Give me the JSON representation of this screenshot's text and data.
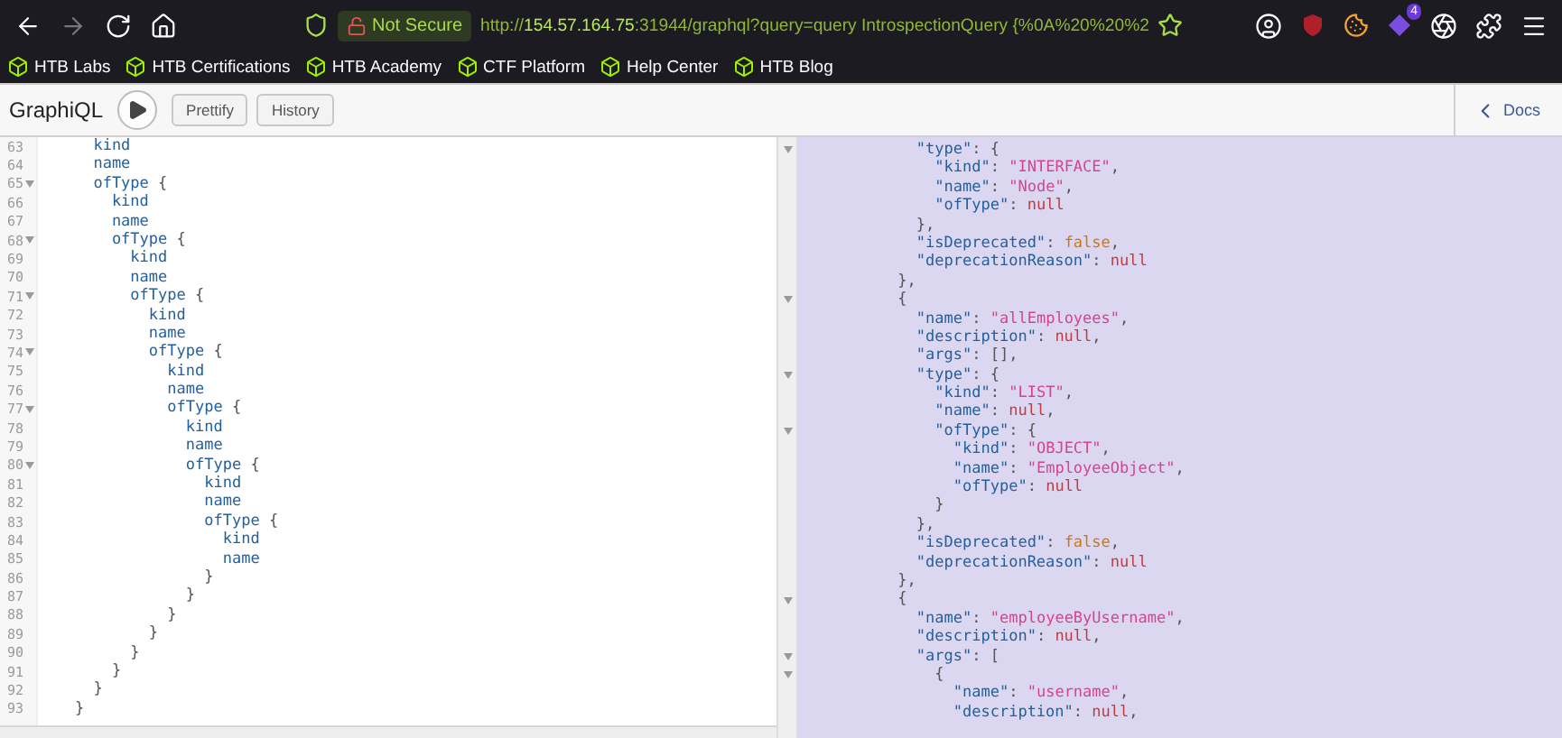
{
  "browser": {
    "security_badge": "Not Secure",
    "url": "http://**154.57.164.75**:31944/graphql?query=query IntrospectionQuery {%0A%20%20%2",
    "extension_badge": "4",
    "bookmarks": [
      "HTB Labs",
      "HTB Certifications",
      "HTB Academy",
      "CTF Platform",
      "Help Center",
      "HTB Blog"
    ]
  },
  "graphiql": {
    "title": "GraphiQL",
    "buttons": [
      "Prettify",
      "History"
    ],
    "docs_button": "Docs",
    "query_editor": {
      "lines": [
        {
          "number": "63",
          "foldable": false,
          "tokens": [
            {
              "kind": "field",
              "text": "      kind"
            }
          ]
        },
        {
          "number": "64",
          "foldable": false,
          "tokens": [
            {
              "kind": "field",
              "text": "      name"
            }
          ]
        },
        {
          "number": "65",
          "foldable": true,
          "tokens": [
            {
              "kind": "field",
              "text": "      ofType"
            },
            {
              "kind": "punct",
              "text": " {"
            }
          ]
        },
        {
          "number": "66",
          "foldable": false,
          "tokens": [
            {
              "kind": "field",
              "text": "        kind"
            }
          ]
        },
        {
          "number": "67",
          "foldable": false,
          "tokens": [
            {
              "kind": "field",
              "text": "        name"
            }
          ]
        },
        {
          "number": "68",
          "foldable": true,
          "tokens": [
            {
              "kind": "field",
              "text": "        ofType"
            },
            {
              "kind": "punct",
              "text": " {"
            }
          ]
        },
        {
          "number": "69",
          "foldable": false,
          "tokens": [
            {
              "kind": "field",
              "text": "          kind"
            }
          ]
        },
        {
          "number": "70",
          "foldable": false,
          "tokens": [
            {
              "kind": "field",
              "text": "          name"
            }
          ]
        },
        {
          "number": "71",
          "foldable": true,
          "tokens": [
            {
              "kind": "field",
              "text": "          ofType"
            },
            {
              "kind": "punct",
              "text": " {"
            }
          ]
        },
        {
          "number": "72",
          "foldable": false,
          "tokens": [
            {
              "kind": "field",
              "text": "            kind"
            }
          ]
        },
        {
          "number": "73",
          "foldable": false,
          "tokens": [
            {
              "kind": "field",
              "text": "            name"
            }
          ]
        },
        {
          "number": "74",
          "foldable": true,
          "tokens": [
            {
              "kind": "field",
              "text": "            ofType"
            },
            {
              "kind": "punct",
              "text": " {"
            }
          ]
        },
        {
          "number": "75",
          "foldable": false,
          "tokens": [
            {
              "kind": "field",
              "text": "              kind"
            }
          ]
        },
        {
          "number": "76",
          "foldable": false,
          "tokens": [
            {
              "kind": "field",
              "text": "              name"
            }
          ]
        },
        {
          "number": "77",
          "foldable": true,
          "tokens": [
            {
              "kind": "field",
              "text": "              ofType"
            },
            {
              "kind": "punct",
              "text": " {"
            }
          ]
        },
        {
          "number": "78",
          "foldable": false,
          "tokens": [
            {
              "kind": "field",
              "text": "                kind"
            }
          ]
        },
        {
          "number": "79",
          "foldable": false,
          "tokens": [
            {
              "kind": "field",
              "text": "                name"
            }
          ]
        },
        {
          "number": "80",
          "foldable": true,
          "tokens": [
            {
              "kind": "field",
              "text": "                ofType"
            },
            {
              "kind": "punct",
              "text": " {"
            }
          ]
        },
        {
          "number": "81",
          "foldable": false,
          "tokens": [
            {
              "kind": "field",
              "text": "                  kind"
            }
          ]
        },
        {
          "number": "82",
          "foldable": false,
          "tokens": [
            {
              "kind": "field",
              "text": "                  name"
            }
          ]
        },
        {
          "number": "83",
          "foldable": false,
          "tokens": [
            {
              "kind": "field",
              "text": "                  ofType"
            },
            {
              "kind": "punct",
              "text": " {"
            }
          ]
        },
        {
          "number": "84",
          "foldable": false,
          "tokens": [
            {
              "kind": "field",
              "text": "                    kind"
            }
          ]
        },
        {
          "number": "85",
          "foldable": false,
          "tokens": [
            {
              "kind": "field",
              "text": "                    name"
            }
          ]
        },
        {
          "number": "86",
          "foldable": false,
          "tokens": [
            {
              "kind": "punct",
              "text": "                  }"
            }
          ]
        },
        {
          "number": "87",
          "foldable": false,
          "tokens": [
            {
              "kind": "punct",
              "text": "                }"
            }
          ]
        },
        {
          "number": "88",
          "foldable": false,
          "tokens": [
            {
              "kind": "punct",
              "text": "              }"
            }
          ]
        },
        {
          "number": "89",
          "foldable": false,
          "tokens": [
            {
              "kind": "punct",
              "text": "            }"
            }
          ]
        },
        {
          "number": "90",
          "foldable": false,
          "tokens": [
            {
              "kind": "punct",
              "text": "          }"
            }
          ]
        },
        {
          "number": "91",
          "foldable": false,
          "tokens": [
            {
              "kind": "punct",
              "text": "        }"
            }
          ]
        },
        {
          "number": "92",
          "foldable": false,
          "tokens": [
            {
              "kind": "punct",
              "text": "      }"
            }
          ]
        },
        {
          "number": "93",
          "foldable": false,
          "tokens": [
            {
              "kind": "punct",
              "text": "    }"
            }
          ]
        }
      ]
    },
    "result_viewer": {
      "lines": [
        {
          "foldable": true,
          "tokens": [
            {
              "kind": "key",
              "text": "            \"type\""
            },
            {
              "kind": "punct",
              "text": ": {"
            }
          ]
        },
        {
          "foldable": false,
          "tokens": [
            {
              "kind": "key",
              "text": "              \"kind\""
            },
            {
              "kind": "punct",
              "text": ": "
            },
            {
              "kind": "string",
              "text": "\"INTERFACE\""
            },
            {
              "kind": "punct",
              "text": ","
            }
          ]
        },
        {
          "foldable": false,
          "tokens": [
            {
              "kind": "key",
              "text": "              \"name\""
            },
            {
              "kind": "punct",
              "text": ": "
            },
            {
              "kind": "string",
              "text": "\"Node\""
            },
            {
              "kind": "punct",
              "text": ","
            }
          ]
        },
        {
          "foldable": false,
          "tokens": [
            {
              "kind": "key",
              "text": "              \"ofType\""
            },
            {
              "kind": "punct",
              "text": ": "
            },
            {
              "kind": "null",
              "text": "null"
            }
          ]
        },
        {
          "foldable": false,
          "tokens": [
            {
              "kind": "punct",
              "text": "            },"
            }
          ]
        },
        {
          "foldable": false,
          "tokens": [
            {
              "kind": "key",
              "text": "            \"isDeprecated\""
            },
            {
              "kind": "punct",
              "text": ": "
            },
            {
              "kind": "bool",
              "text": "false"
            },
            {
              "kind": "punct",
              "text": ","
            }
          ]
        },
        {
          "foldable": false,
          "tokens": [
            {
              "kind": "key",
              "text": "            \"deprecationReason\""
            },
            {
              "kind": "punct",
              "text": ": "
            },
            {
              "kind": "null",
              "text": "null"
            }
          ]
        },
        {
          "foldable": false,
          "tokens": [
            {
              "kind": "punct",
              "text": "          },"
            }
          ]
        },
        {
          "foldable": true,
          "tokens": [
            {
              "kind": "punct",
              "text": "          {"
            }
          ]
        },
        {
          "foldable": false,
          "tokens": [
            {
              "kind": "key",
              "text": "            \"name\""
            },
            {
              "kind": "punct",
              "text": ": "
            },
            {
              "kind": "string",
              "text": "\"allEmployees\""
            },
            {
              "kind": "punct",
              "text": ","
            }
          ]
        },
        {
          "foldable": false,
          "tokens": [
            {
              "kind": "key",
              "text": "            \"description\""
            },
            {
              "kind": "punct",
              "text": ": "
            },
            {
              "kind": "null",
              "text": "null"
            },
            {
              "kind": "punct",
              "text": ","
            }
          ]
        },
        {
          "foldable": false,
          "tokens": [
            {
              "kind": "key",
              "text": "            \"args\""
            },
            {
              "kind": "punct",
              "text": ": [],"
            }
          ]
        },
        {
          "foldable": true,
          "tokens": [
            {
              "kind": "key",
              "text": "            \"type\""
            },
            {
              "kind": "punct",
              "text": ": {"
            }
          ]
        },
        {
          "foldable": false,
          "tokens": [
            {
              "kind": "key",
              "text": "              \"kind\""
            },
            {
              "kind": "punct",
              "text": ": "
            },
            {
              "kind": "string",
              "text": "\"LIST\""
            },
            {
              "kind": "punct",
              "text": ","
            }
          ]
        },
        {
          "foldable": false,
          "tokens": [
            {
              "kind": "key",
              "text": "              \"name\""
            },
            {
              "kind": "punct",
              "text": ": "
            },
            {
              "kind": "null",
              "text": "null"
            },
            {
              "kind": "punct",
              "text": ","
            }
          ]
        },
        {
          "foldable": true,
          "tokens": [
            {
              "kind": "key",
              "text": "              \"ofType\""
            },
            {
              "kind": "punct",
              "text": ": {"
            }
          ]
        },
        {
          "foldable": false,
          "tokens": [
            {
              "kind": "key",
              "text": "                \"kind\""
            },
            {
              "kind": "punct",
              "text": ": "
            },
            {
              "kind": "string",
              "text": "\"OBJECT\""
            },
            {
              "kind": "punct",
              "text": ","
            }
          ]
        },
        {
          "foldable": false,
          "tokens": [
            {
              "kind": "key",
              "text": "                \"name\""
            },
            {
              "kind": "punct",
              "text": ": "
            },
            {
              "kind": "string",
              "text": "\"EmployeeObject\""
            },
            {
              "kind": "punct",
              "text": ","
            }
          ]
        },
        {
          "foldable": false,
          "tokens": [
            {
              "kind": "key",
              "text": "                \"ofType\""
            },
            {
              "kind": "punct",
              "text": ": "
            },
            {
              "kind": "null",
              "text": "null"
            }
          ]
        },
        {
          "foldable": false,
          "tokens": [
            {
              "kind": "punct",
              "text": "              }"
            }
          ]
        },
        {
          "foldable": false,
          "tokens": [
            {
              "kind": "punct",
              "text": "            },"
            }
          ]
        },
        {
          "foldable": false,
          "tokens": [
            {
              "kind": "key",
              "text": "            \"isDeprecated\""
            },
            {
              "kind": "punct",
              "text": ": "
            },
            {
              "kind": "bool",
              "text": "false"
            },
            {
              "kind": "punct",
              "text": ","
            }
          ]
        },
        {
          "foldable": false,
          "tokens": [
            {
              "kind": "key",
              "text": "            \"deprecationReason\""
            },
            {
              "kind": "punct",
              "text": ": "
            },
            {
              "kind": "null",
              "text": "null"
            }
          ]
        },
        {
          "foldable": false,
          "tokens": [
            {
              "kind": "punct",
              "text": "          },"
            }
          ]
        },
        {
          "foldable": true,
          "tokens": [
            {
              "kind": "punct",
              "text": "          {"
            }
          ]
        },
        {
          "foldable": false,
          "tokens": [
            {
              "kind": "key",
              "text": "            \"name\""
            },
            {
              "kind": "punct",
              "text": ": "
            },
            {
              "kind": "string",
              "text": "\"employeeByUsername\""
            },
            {
              "kind": "punct",
              "text": ","
            }
          ]
        },
        {
          "foldable": false,
          "tokens": [
            {
              "kind": "key",
              "text": "            \"description\""
            },
            {
              "kind": "punct",
              "text": ": "
            },
            {
              "kind": "null",
              "text": "null"
            },
            {
              "kind": "punct",
              "text": ","
            }
          ]
        },
        {
          "foldable": true,
          "tokens": [
            {
              "kind": "key",
              "text": "            \"args\""
            },
            {
              "kind": "punct",
              "text": ": ["
            }
          ]
        },
        {
          "foldable": true,
          "tokens": [
            {
              "kind": "punct",
              "text": "              {"
            }
          ]
        },
        {
          "foldable": false,
          "tokens": [
            {
              "kind": "key",
              "text": "                \"name\""
            },
            {
              "kind": "punct",
              "text": ": "
            },
            {
              "kind": "string",
              "text": "\"username\""
            },
            {
              "kind": "punct",
              "text": ","
            }
          ]
        },
        {
          "foldable": false,
          "tokens": [
            {
              "kind": "key",
              "text": "                \"description\""
            },
            {
              "kind": "punct",
              "text": ": "
            },
            {
              "kind": "null",
              "text": "null"
            },
            {
              "kind": "punct",
              "text": ","
            }
          ]
        }
      ]
    }
  }
}
